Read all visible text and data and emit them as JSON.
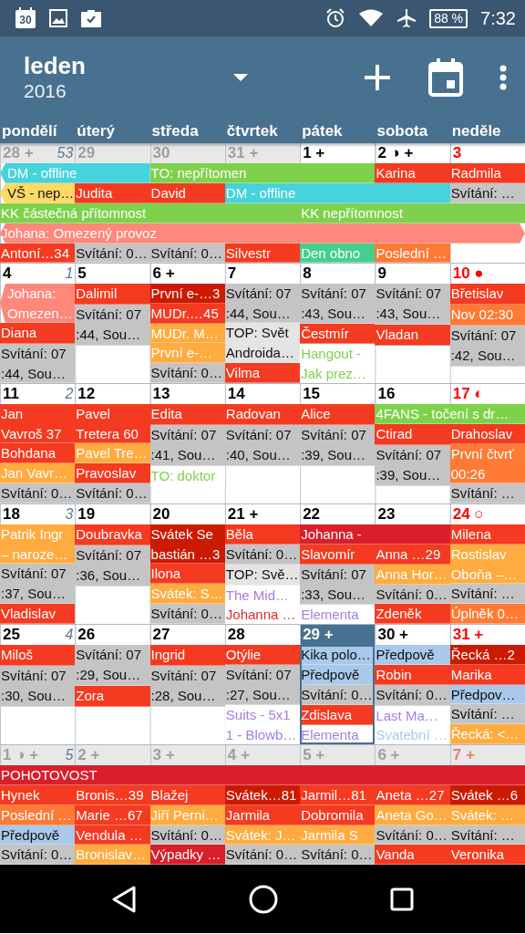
{
  "status_bar": {
    "calendar_day": "30",
    "battery": "88 %",
    "time": "7:32"
  },
  "toolbar": {
    "month": "leden",
    "year": "2016"
  },
  "weekdays": [
    "pondělí",
    "úterý",
    "středa",
    "čtvrtek",
    "pátek",
    "sobota",
    "neděle"
  ],
  "weeks": [
    {
      "days": [
        {
          "label": "28 +",
          "week_number": "53",
          "muted": true,
          "holiday": false,
          "today": false
        },
        {
          "label": "29",
          "muted": true,
          "holiday": false,
          "today": false
        },
        {
          "label": "30",
          "muted": true,
          "holiday": false,
          "today": false
        },
        {
          "label": "31 +",
          "muted": true,
          "holiday": false,
          "today": false
        },
        {
          "label": "1 +",
          "muted": false,
          "holiday": false,
          "today": false
        },
        {
          "label": "2 ◑ +",
          "muted": false,
          "holiday": false,
          "today": false
        },
        {
          "label": "3",
          "muted": false,
          "holiday": true,
          "today": false
        }
      ],
      "lanes": [
        [
          {
            "text": "DM - offline",
            "kind": "fill",
            "color": "#46d3dc",
            "from_before": true
          },
          {
            "kind": "continued"
          },
          {
            "text": "TO: nepřítomen",
            "kind": "fill",
            "color": "#7ed24b"
          },
          {
            "kind": "continued"
          },
          {
            "kind": "continued"
          },
          {
            "text": "Karina",
            "kind": "fill",
            "color": "#f43a20"
          },
          {
            "text": "Radmila",
            "kind": "fill",
            "color": "#f43a20"
          }
        ],
        [
          {
            "text": "VŠ - nep…",
            "kind": "fill-dark",
            "color": "#ffd865",
            "from_before": true
          },
          {
            "text": "Judita",
            "kind": "fill",
            "color": "#f43a20"
          },
          {
            "text": "David",
            "kind": "fill",
            "color": "#f43a20"
          },
          {
            "text": "DM - offline",
            "kind": "fill",
            "color": "#46d3dc"
          },
          {
            "kind": "continued"
          },
          {
            "kind": "continued"
          },
          {
            "text": "Svítání: …",
            "kind": "fill-dark",
            "color": "#c4c4c4"
          }
        ],
        [
          {
            "text": "KK částečná přítomnost",
            "kind": "fill",
            "color": "#7ed24b"
          },
          {
            "kind": "continued"
          },
          {
            "kind": "continued"
          },
          {
            "kind": "continued"
          },
          {
            "text": "KK nepřítomnost",
            "kind": "fill",
            "color": "#7ed24b"
          },
          {
            "kind": "continued"
          },
          {
            "kind": "continued"
          }
        ],
        [
          {
            "text": "Johana: Omezený provoz",
            "kind": "fill",
            "color": "#ff877b",
            "from_before": true,
            "to_after": true
          },
          {
            "kind": "continued"
          },
          {
            "kind": "continued"
          },
          {
            "kind": "continued"
          },
          {
            "kind": "continued"
          },
          {
            "kind": "continued"
          },
          {
            "kind": "continued"
          }
        ]
      ],
      "cells": [
        [
          {
            "text": "Antoní…34",
            "kind": "fill",
            "color": "#f43a20"
          }
        ],
        [
          {
            "text": "Svítání: 0…",
            "kind": "fill-dark",
            "color": "#c4c4c4"
          }
        ],
        [
          {
            "text": "Svítání: 0…",
            "kind": "fill-dark",
            "color": "#c4c4c4"
          }
        ],
        [
          {
            "text": "Silvestr",
            "kind": "fill",
            "color": "#f43a20"
          }
        ],
        [
          {
            "text": "Den obno",
            "kind": "fill",
            "color": "#44cf8c"
          }
        ],
        [
          {
            "text": "Poslední …",
            "kind": "fill",
            "color": "#ff7a35"
          }
        ],
        []
      ]
    },
    {
      "days": [
        {
          "label": "4",
          "week_number": "1",
          "muted": false,
          "holiday": false,
          "today": false
        },
        {
          "label": "5",
          "muted": false,
          "holiday": false,
          "today": false
        },
        {
          "label": "6 +",
          "muted": false,
          "holiday": false,
          "today": false
        },
        {
          "label": "7",
          "muted": false,
          "holiday": false,
          "today": false
        },
        {
          "label": "8",
          "muted": false,
          "holiday": false,
          "today": false
        },
        {
          "label": "9",
          "muted": false,
          "holiday": false,
          "today": false
        },
        {
          "label": "10 ●",
          "muted": false,
          "holiday": true,
          "today": false
        }
      ],
      "cells": [
        [
          {
            "text": "Johana:\nOmezen…",
            "kind": "fill",
            "color": "#ff877b",
            "from_before": true
          },
          {
            "text": "Diana",
            "kind": "fill",
            "color": "#f43a20"
          },
          {
            "text": "Svítání: 07\n:44, Sou…",
            "kind": "fill-dark",
            "color": "#c4c4c4"
          }
        ],
        [
          {
            "text": "Dalimil",
            "kind": "fill",
            "color": "#f43a20"
          },
          {
            "text": "Svítání: 07\n:44, Sou…",
            "kind": "fill-dark",
            "color": "#c4c4c4"
          }
        ],
        [
          {
            "text": "První e-…3",
            "kind": "fill",
            "color": "#cc1a00"
          },
          {
            "text": "MUDr.…45",
            "kind": "fill",
            "color": "#f43a20"
          },
          {
            "text": "MUDr. M…",
            "kind": "fill",
            "color": "#ffab40"
          },
          {
            "text": "První e-…",
            "kind": "fill",
            "color": "#ffab40"
          },
          {
            "text": "Svítání: 0…",
            "kind": "fill-dark",
            "color": "#c4c4c4"
          }
        ],
        [
          {
            "text": "Svítání: 07\n:44, Sou…",
            "kind": "fill-dark",
            "color": "#c4c4c4"
          },
          {
            "text": "TOP: Svět\nAndroida…",
            "kind": "fill-dark",
            "color": "#e4e4e4"
          },
          {
            "text": "Vilma",
            "kind": "fill",
            "color": "#f43a20"
          }
        ],
        [
          {
            "text": "Svítání: 07\n:43, Sou…",
            "kind": "fill-dark",
            "color": "#c4c4c4"
          },
          {
            "text": "Čestmír",
            "kind": "fill",
            "color": "#f43a20"
          },
          {
            "text": "Hangout -\nJak prez…",
            "kind": "text",
            "color": "#7ed24b"
          }
        ],
        [
          {
            "text": "Svítání: 07\n:43, Sou…",
            "kind": "fill-dark",
            "color": "#c4c4c4"
          },
          {
            "text": "Vladan",
            "kind": "fill",
            "color": "#f43a20"
          }
        ],
        [
          {
            "text": "Břetislav",
            "kind": "fill",
            "color": "#f43a20"
          },
          {
            "text": "Nov 02:30",
            "kind": "fill",
            "color": "#ff7a35"
          },
          {
            "text": "Svítání: 07\n:42, Sou…",
            "kind": "fill-dark",
            "color": "#c4c4c4"
          }
        ]
      ]
    },
    {
      "days": [
        {
          "label": "11",
          "week_number": "2",
          "muted": false,
          "holiday": false,
          "today": false
        },
        {
          "label": "12",
          "muted": false,
          "holiday": false,
          "today": false
        },
        {
          "label": "13",
          "muted": false,
          "holiday": false,
          "today": false
        },
        {
          "label": "14",
          "muted": false,
          "holiday": false,
          "today": false
        },
        {
          "label": "15",
          "muted": false,
          "holiday": false,
          "today": false
        },
        {
          "label": "16",
          "muted": false,
          "holiday": false,
          "today": false
        },
        {
          "label": "17 ◐",
          "muted": false,
          "holiday": true,
          "today": false
        }
      ],
      "lanes": [
        [
          {
            "kind": "empty"
          },
          {
            "kind": "empty"
          },
          {
            "kind": "empty"
          },
          {
            "kind": "empty"
          },
          {
            "kind": "empty"
          },
          {
            "text": "4FANS - točení s dr…",
            "kind": "fill",
            "color": "#7ed24b"
          },
          {
            "kind": "continued"
          }
        ]
      ],
      "cells": [
        [
          {
            "text": "Jan\nVavroš 37",
            "kind": "fill",
            "color": "#f43a20"
          },
          {
            "text": "Bohdana",
            "kind": "fill",
            "color": "#f43a20"
          },
          {
            "text": "Jan Vavr…",
            "kind": "fill",
            "color": "#ffab40"
          },
          {
            "text": "Svítání: 0…",
            "kind": "fill-dark",
            "color": "#c4c4c4"
          }
        ],
        [
          {
            "text": "Pavel\nTretera 60",
            "kind": "fill",
            "color": "#f43a20"
          },
          {
            "text": "Pavel Tre…",
            "kind": "fill",
            "color": "#ffab40"
          },
          {
            "text": "Pravoslav",
            "kind": "fill",
            "color": "#f43a20"
          },
          {
            "text": "Svítání: 0…",
            "kind": "fill-dark",
            "color": "#c4c4c4"
          }
        ],
        [
          {
            "text": "Edita",
            "kind": "fill",
            "color": "#f43a20"
          },
          {
            "text": "Svítání: 07\n:41, Sou…",
            "kind": "fill-dark",
            "color": "#c4c4c4"
          },
          {
            "text": "TO: doktor",
            "kind": "text",
            "color": "#7ed24b"
          }
        ],
        [
          {
            "text": "Radovan",
            "kind": "fill",
            "color": "#f43a20"
          },
          {
            "text": "Svítání: 07\n:40, Sou…",
            "kind": "fill-dark",
            "color": "#c4c4c4"
          }
        ],
        [
          {
            "text": "Alice",
            "kind": "fill",
            "color": "#f43a20"
          },
          {
            "text": "Svítání: 07\n:39, Sou…",
            "kind": "fill-dark",
            "color": "#c4c4c4"
          }
        ],
        [
          {
            "text": "Ctirad",
            "kind": "fill",
            "color": "#f43a20"
          },
          {
            "text": "Svítání: 07\n:39, Sou…",
            "kind": "fill-dark",
            "color": "#c4c4c4"
          }
        ],
        [
          {
            "text": "Drahoslav",
            "kind": "fill",
            "color": "#f43a20"
          },
          {
            "text": "První čtvrť\n00:26",
            "kind": "fill",
            "color": "#ff7a35"
          },
          {
            "text": "Svítání: …",
            "kind": "fill-dark",
            "color": "#c4c4c4"
          }
        ]
      ]
    },
    {
      "days": [
        {
          "label": "18",
          "week_number": "3",
          "muted": false,
          "holiday": false,
          "today": false
        },
        {
          "label": "19",
          "muted": false,
          "holiday": false,
          "today": false
        },
        {
          "label": "20",
          "muted": false,
          "holiday": false,
          "today": false
        },
        {
          "label": "21 +",
          "muted": false,
          "holiday": false,
          "today": false
        },
        {
          "label": "22",
          "muted": false,
          "holiday": false,
          "today": false
        },
        {
          "label": "23",
          "muted": false,
          "holiday": false,
          "today": false
        },
        {
          "label": "24 ○",
          "muted": false,
          "holiday": true,
          "today": false
        }
      ],
      "lanes": [
        [
          {
            "kind": "empty"
          },
          {
            "kind": "empty"
          },
          {
            "kind": "empty"
          },
          {
            "kind": "empty"
          },
          {
            "text": "Johanna -",
            "kind": "fill",
            "color": "#d81f2a"
          },
          {
            "kind": "continued"
          },
          {
            "kind": "empty"
          }
        ]
      ],
      "cells": [
        [
          {
            "text": "Patrik Ingr\n– naroze…",
            "kind": "fill",
            "color": "#ffab40"
          },
          {
            "text": "Svítání: 07\n:37, Sou…",
            "kind": "fill-dark",
            "color": "#c4c4c4"
          },
          {
            "text": "Vladislav",
            "kind": "fill",
            "color": "#f43a20"
          }
        ],
        [
          {
            "text": "Doubravka",
            "kind": "fill",
            "color": "#f43a20"
          },
          {
            "text": "Svítání: 07\n:36, Sou…",
            "kind": "fill-dark",
            "color": "#c4c4c4"
          }
        ],
        [
          {
            "text": "Svátek Se\nbastián …3",
            "kind": "fill",
            "color": "#cc1a00"
          },
          {
            "text": "Ilona",
            "kind": "fill",
            "color": "#f43a20"
          },
          {
            "text": "Svátek: S…",
            "kind": "fill",
            "color": "#ffab40"
          },
          {
            "text": "Svítání: 0…",
            "kind": "fill-dark",
            "color": "#c4c4c4"
          }
        ],
        [
          {
            "text": "Běla",
            "kind": "fill",
            "color": "#f43a20"
          },
          {
            "text": "Svítání: 0…",
            "kind": "fill-dark",
            "color": "#c4c4c4"
          },
          {
            "text": "TOP: Svě…",
            "kind": "fill-dark",
            "color": "#e4e4e4"
          },
          {
            "text": "The Mid…",
            "kind": "text",
            "color": "#a57fe0"
          },
          {
            "text": "Johanna …",
            "kind": "text",
            "color": "#e8262a"
          }
        ],
        [
          {
            "text": "Slavomír",
            "kind": "fill",
            "color": "#f43a20"
          },
          {
            "text": "Svítání: 07\n:33, Sou…",
            "kind": "fill-dark",
            "color": "#c4c4c4"
          },
          {
            "text": "Elementa",
            "kind": "text",
            "color": "#a57fe0"
          }
        ],
        [
          {
            "text": "Anna …29",
            "kind": "fill",
            "color": "#f43a20"
          },
          {
            "text": "Anna Hor…",
            "kind": "fill",
            "color": "#ffab40"
          },
          {
            "text": "Svítání: 0…",
            "kind": "fill-dark",
            "color": "#c4c4c4"
          },
          {
            "text": "Zdeněk",
            "kind": "fill",
            "color": "#f43a20"
          }
        ],
        [
          {
            "text": "Milena",
            "kind": "fill",
            "color": "#f43a20"
          },
          {
            "text": "Rostislav\nOboňa –…",
            "kind": "fill",
            "color": "#ffab40"
          },
          {
            "text": "Svítání: …",
            "kind": "fill-dark",
            "color": "#c4c4c4"
          },
          {
            "text": "Úplněk 0…",
            "kind": "fill",
            "color": "#ff7a35"
          }
        ]
      ]
    },
    {
      "days": [
        {
          "label": "25",
          "week_number": "4",
          "muted": false,
          "holiday": false,
          "today": false
        },
        {
          "label": "26",
          "muted": false,
          "holiday": false,
          "today": false
        },
        {
          "label": "27",
          "muted": false,
          "holiday": false,
          "today": false
        },
        {
          "label": "28",
          "muted": false,
          "holiday": false,
          "today": false
        },
        {
          "label": "29 +",
          "muted": false,
          "holiday": false,
          "today": true
        },
        {
          "label": "30 +",
          "muted": false,
          "holiday": false,
          "today": false
        },
        {
          "label": "31 +",
          "muted": false,
          "holiday": true,
          "today": false
        }
      ],
      "cells": [
        [
          {
            "text": "Miloš",
            "kind": "fill",
            "color": "#f43a20"
          },
          {
            "text": "Svítání: 07\n:30, Sou…",
            "kind": "fill-dark",
            "color": "#c4c4c4"
          }
        ],
        [
          {
            "text": "Svítání: 07\n:29, Sou…",
            "kind": "fill-dark",
            "color": "#c4c4c4"
          },
          {
            "text": "Zora",
            "kind": "fill",
            "color": "#f43a20"
          }
        ],
        [
          {
            "text": "Ingrid",
            "kind": "fill",
            "color": "#f43a20"
          },
          {
            "text": "Svítání: 07\n:28, Sou…",
            "kind": "fill-dark",
            "color": "#c4c4c4"
          }
        ],
        [
          {
            "text": "Otýlie",
            "kind": "fill",
            "color": "#f43a20"
          },
          {
            "text": "Svítání: 07\n:27, Sou…",
            "kind": "fill-dark",
            "color": "#c4c4c4"
          },
          {
            "text": "Suits - 5x1\n1 - Blowb…",
            "kind": "text",
            "color": "#a57fe0"
          }
        ],
        [
          {
            "text": "Kika polo…",
            "kind": "fill-dark",
            "color": "#a8c9e9"
          },
          {
            "text": "Předpově",
            "kind": "fill-dark",
            "color": "#a8c9e9"
          },
          {
            "text": "Svítání: 0…",
            "kind": "fill-dark",
            "color": "#c4c4c4"
          },
          {
            "text": "Zdislava",
            "kind": "fill",
            "color": "#f43a20"
          },
          {
            "text": "Elementa",
            "kind": "text",
            "color": "#a57fe0"
          }
        ],
        [
          {
            "text": "Předpově",
            "kind": "fill-dark",
            "color": "#a8c9e9"
          },
          {
            "text": "Robin",
            "kind": "fill",
            "color": "#f43a20"
          },
          {
            "text": "Svítání: 0…",
            "kind": "fill-dark",
            "color": "#c4c4c4"
          },
          {
            "text": "Last Ma…",
            "kind": "text",
            "color": "#a57fe0"
          },
          {
            "text": "Svatební …",
            "kind": "text",
            "color": "#a8c9e9"
          }
        ],
        [
          {
            "text": "Řecká …2",
            "kind": "fill",
            "color": "#cc1a00"
          },
          {
            "text": "Marika",
            "kind": "fill",
            "color": "#f43a20"
          },
          {
            "text": "Předpov…",
            "kind": "fill-dark",
            "color": "#a8c9e9"
          },
          {
            "text": "Svítání: …",
            "kind": "fill-dark",
            "color": "#c4c4c4"
          },
          {
            "text": "Řecká: <…",
            "kind": "fill",
            "color": "#ffab40"
          }
        ]
      ]
    },
    {
      "days": [
        {
          "label": "1 ◑ +",
          "week_number": "5",
          "muted": true,
          "holiday": false,
          "today": false
        },
        {
          "label": "2 +",
          "muted": true,
          "holiday": false,
          "today": false
        },
        {
          "label": "3 +",
          "muted": true,
          "holiday": false,
          "today": false
        },
        {
          "label": "4 +",
          "muted": true,
          "holiday": false,
          "today": false
        },
        {
          "label": "5 +",
          "muted": true,
          "holiday": false,
          "today": false
        },
        {
          "label": "6 +",
          "muted": true,
          "holiday": false,
          "today": false
        },
        {
          "label": "7 +",
          "muted": true,
          "holiday": true,
          "today": false
        }
      ],
      "lanes": [
        [
          {
            "text": "POHOTOVOST",
            "kind": "fill",
            "color": "#d81f2a"
          },
          {
            "kind": "continued"
          },
          {
            "kind": "continued"
          },
          {
            "kind": "continued"
          },
          {
            "kind": "continued"
          },
          {
            "kind": "continued"
          },
          {
            "kind": "continued"
          }
        ]
      ],
      "cells": [
        [
          {
            "text": "Hynek",
            "kind": "fill",
            "color": "#f43a20"
          },
          {
            "text": "Poslední …",
            "kind": "fill",
            "color": "#ff7a35"
          },
          {
            "text": "Předpově",
            "kind": "fill-dark",
            "color": "#a8c9e9"
          },
          {
            "text": "Svítání: 0…",
            "kind": "fill-dark",
            "color": "#c4c4c4"
          }
        ],
        [
          {
            "text": "Bronis…39",
            "kind": "fill",
            "color": "#f43a20"
          },
          {
            "text": "Marie …67",
            "kind": "fill",
            "color": "#f43a20"
          },
          {
            "text": "Vendula …",
            "kind": "fill",
            "color": "#f43a20"
          },
          {
            "text": "Bronislav…",
            "kind": "fill",
            "color": "#ffab40"
          }
        ],
        [
          {
            "text": "Blažej",
            "kind": "fill",
            "color": "#f43a20"
          },
          {
            "text": "Jiří Perni…",
            "kind": "fill",
            "color": "#ffab40"
          },
          {
            "text": "Svítání: 0…",
            "kind": "fill-dark",
            "color": "#c4c4c4"
          },
          {
            "text": "Výpadky …",
            "kind": "fill",
            "color": "#d81f2a"
          }
        ],
        [
          {
            "text": "Svátek…81",
            "kind": "fill",
            "color": "#cc1a00"
          },
          {
            "text": "Jarmila",
            "kind": "fill",
            "color": "#f43a20"
          },
          {
            "text": "Svátek: J…",
            "kind": "fill",
            "color": "#ffab40"
          },
          {
            "text": "Svítání: 0…",
            "kind": "fill-dark",
            "color": "#c4c4c4"
          }
        ],
        [
          {
            "text": "Jarmil…81",
            "kind": "fill",
            "color": "#f43a20"
          },
          {
            "text": "Dobromila",
            "kind": "fill",
            "color": "#f43a20"
          },
          {
            "text": "Jarmila S",
            "kind": "fill",
            "color": "#ffab40"
          },
          {
            "text": "Svítání: 0…",
            "kind": "fill-dark",
            "color": "#c4c4c4"
          }
        ],
        [
          {
            "text": "Aneta …27",
            "kind": "fill",
            "color": "#f43a20"
          },
          {
            "text": "Aneta Go…",
            "kind": "fill",
            "color": "#ffab40"
          },
          {
            "text": "Svítání: 0…",
            "kind": "fill-dark",
            "color": "#c4c4c4"
          },
          {
            "text": "Vanda",
            "kind": "fill",
            "color": "#f43a20"
          }
        ],
        [
          {
            "text": "Svátek …6",
            "kind": "fill",
            "color": "#cc1a00"
          },
          {
            "text": "Svátek: …",
            "kind": "fill",
            "color": "#ffab40"
          },
          {
            "text": "Svítání: …",
            "kind": "fill-dark",
            "color": "#c4c4c4"
          },
          {
            "text": "Veronika",
            "kind": "fill",
            "color": "#f43a20"
          }
        ]
      ]
    }
  ]
}
